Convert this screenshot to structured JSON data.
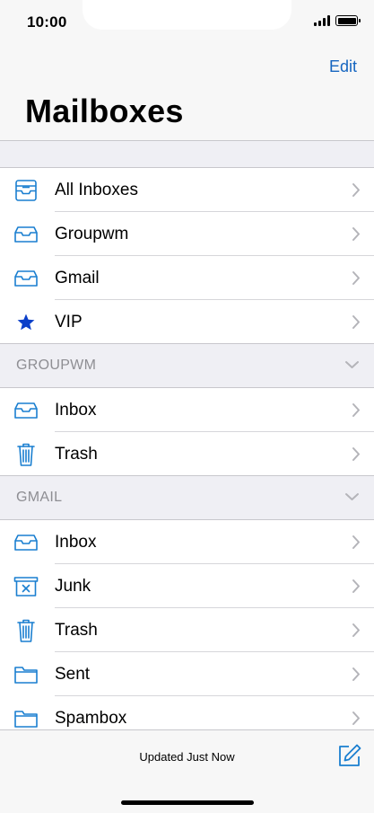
{
  "status_bar": {
    "time": "10:00"
  },
  "nav": {
    "edit_label": "Edit",
    "title": "Mailboxes"
  },
  "mailboxes": [
    {
      "label": "All Inboxes",
      "icon": "all-inboxes-icon"
    },
    {
      "label": "Groupwm",
      "icon": "inbox-tray-icon"
    },
    {
      "label": "Gmail",
      "icon": "inbox-tray-icon"
    },
    {
      "label": "VIP",
      "icon": "star-icon"
    }
  ],
  "sections": [
    {
      "title": "GROUPWM",
      "items": [
        {
          "label": "Inbox",
          "icon": "inbox-tray-icon"
        },
        {
          "label": "Trash",
          "icon": "trash-icon"
        }
      ]
    },
    {
      "title": "GMAIL",
      "items": [
        {
          "label": "Inbox",
          "icon": "inbox-tray-icon"
        },
        {
          "label": "Junk",
          "icon": "junk-icon"
        },
        {
          "label": "Trash",
          "icon": "trash-icon"
        },
        {
          "label": "Sent",
          "icon": "folder-icon"
        },
        {
          "label": "Spambox",
          "icon": "folder-icon"
        }
      ]
    }
  ],
  "toolbar": {
    "status": "Updated Just Now",
    "compose_icon": "compose-icon"
  },
  "colors": {
    "accent": "#1565c0",
    "icon": "#1a7fd0",
    "star": "#0b3fc9",
    "separator": "#c8c7cc"
  }
}
